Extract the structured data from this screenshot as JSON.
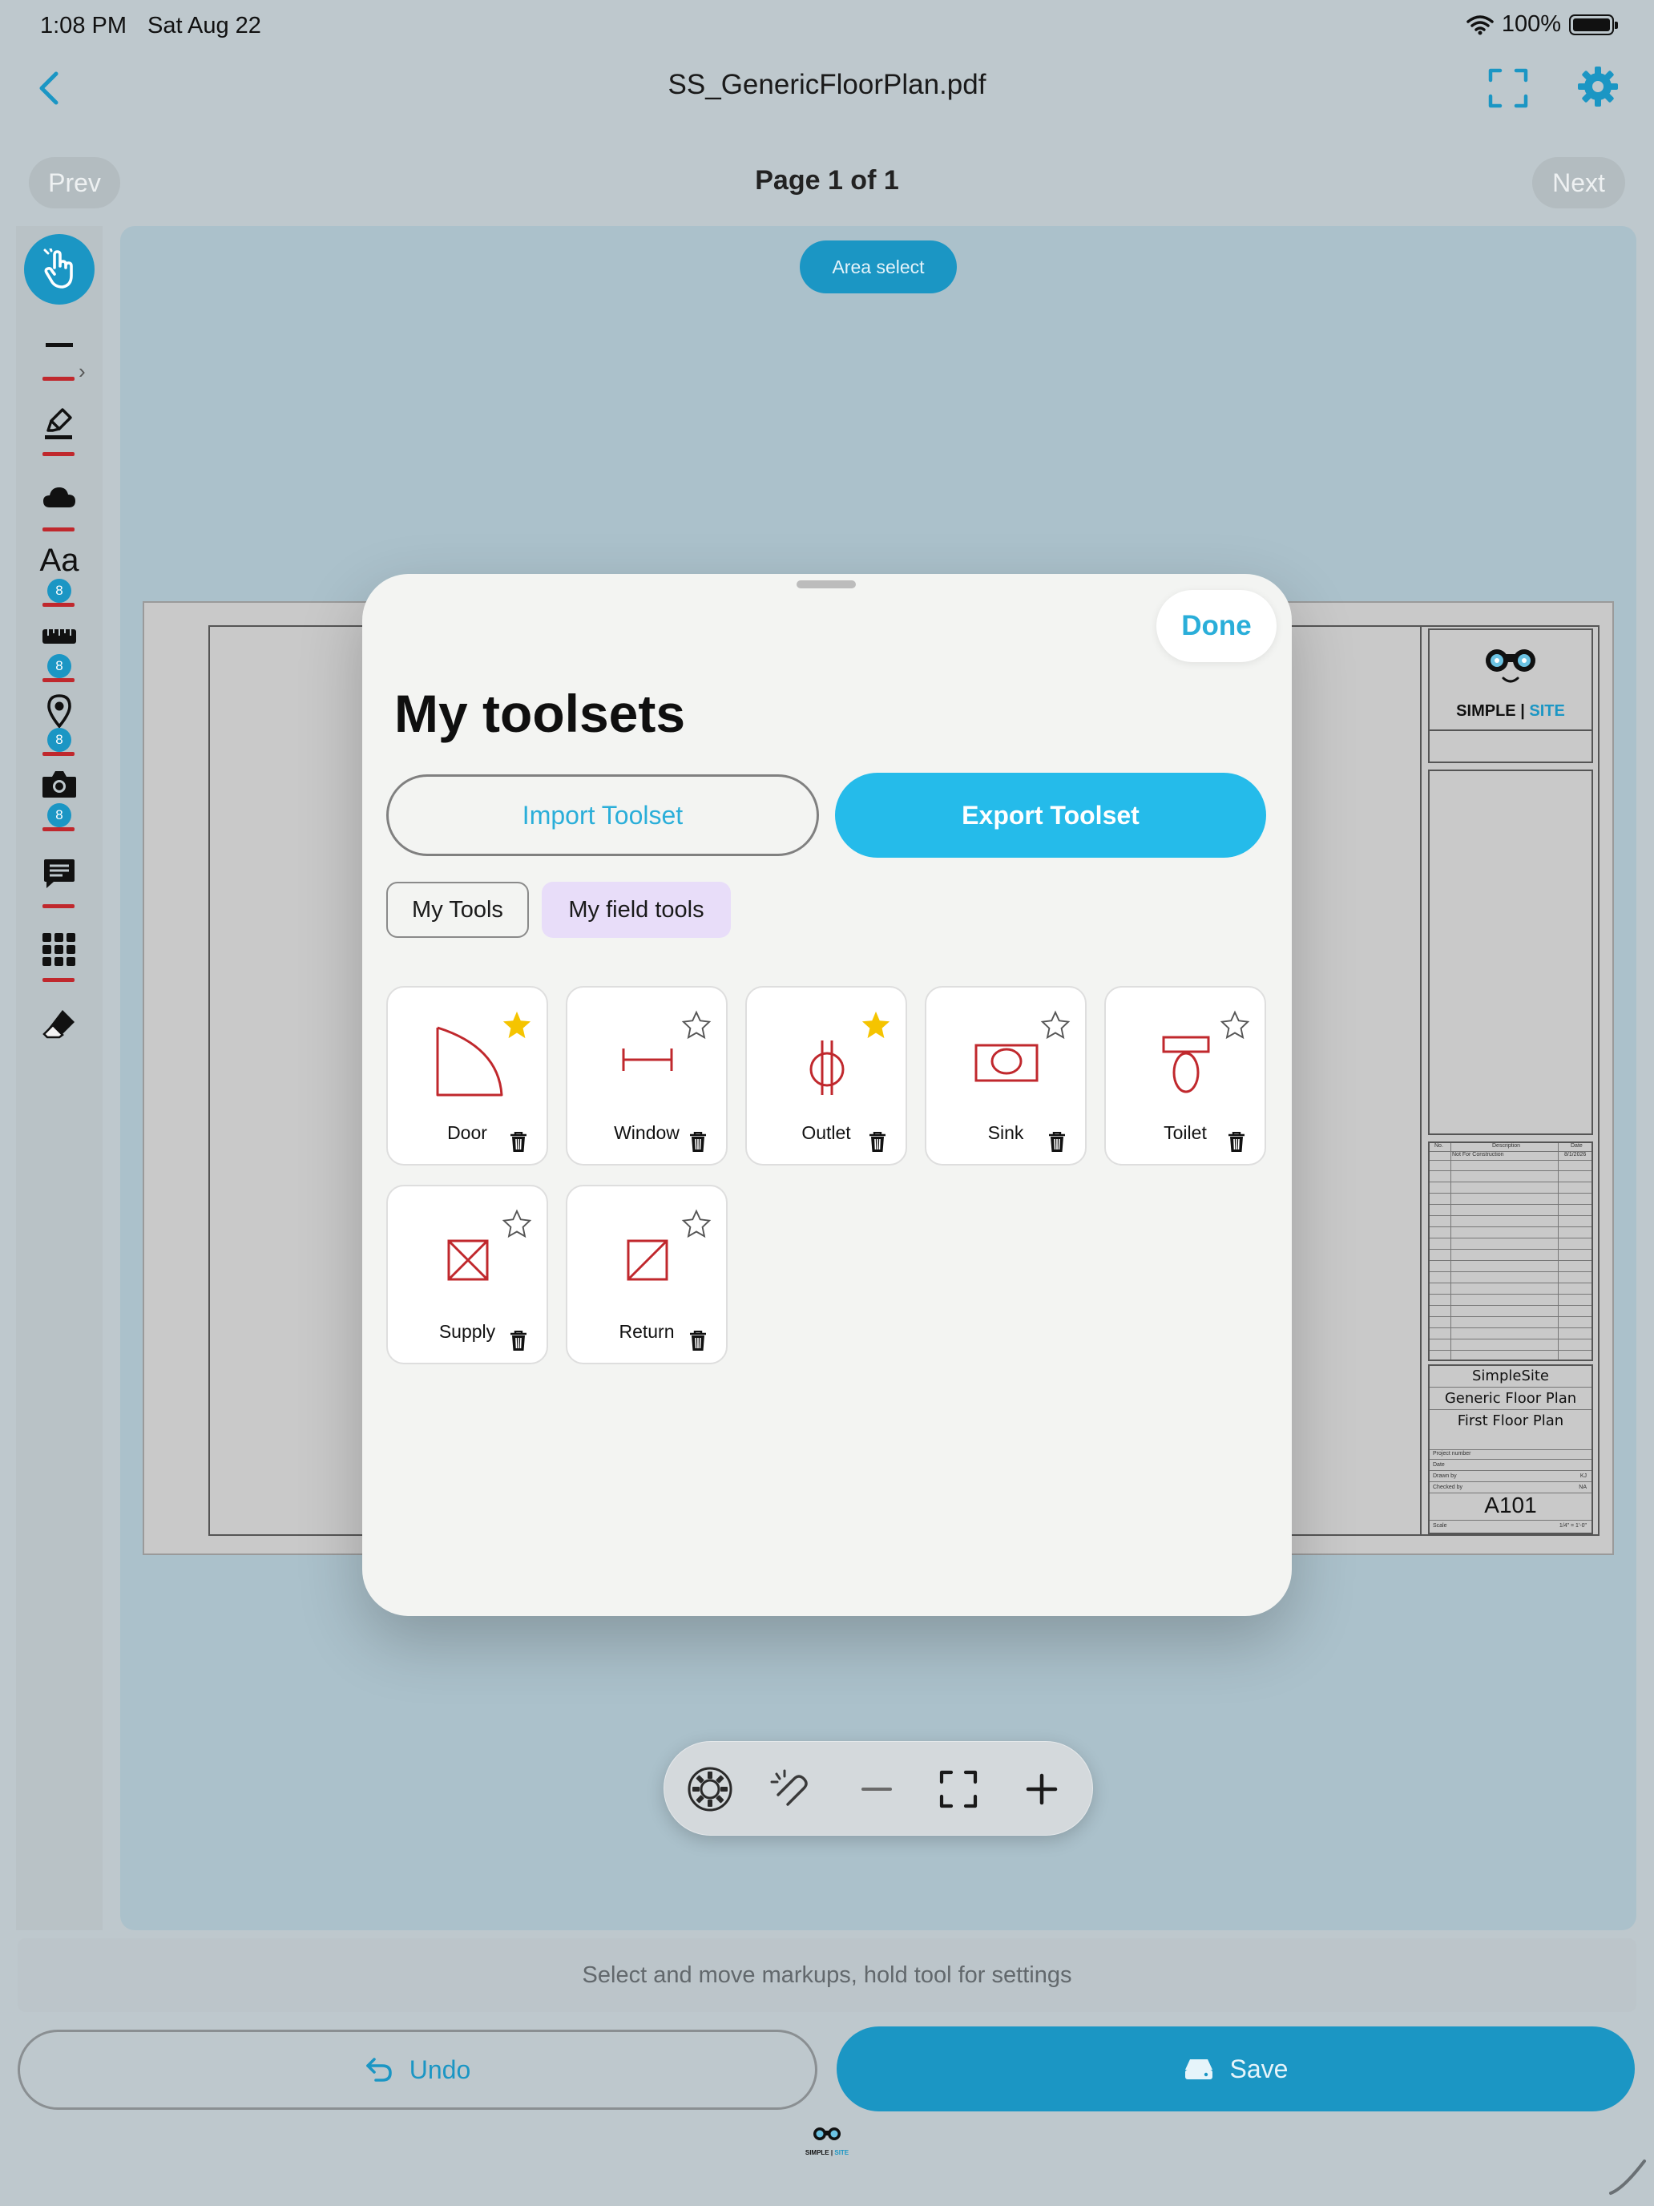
{
  "status_bar": {
    "time": "1:08 PM",
    "date": "Sat Aug 22",
    "battery": "100%"
  },
  "nav": {
    "title": "SS_GenericFloorPlan.pdf"
  },
  "pager": {
    "prev_label": "Prev",
    "next_label": "Next",
    "page_indicator": "Page 1 of 1"
  },
  "sidebar": {
    "badge_count": "8"
  },
  "canvas": {
    "area_select_label": "Area select"
  },
  "pdf": {
    "logo_simple": "SIMPLE",
    "logo_sep": "|",
    "logo_site": "SITE",
    "project_name": "SimpleSite",
    "drawing_title": "Generic Floor Plan",
    "sheet_title": "First Floor Plan",
    "sheet_number": "A101",
    "revision_headers": [
      "No.",
      "Description",
      "Date"
    ],
    "revision_row": [
      "",
      "Not For Construction",
      "8/1/2026"
    ],
    "field_labels": [
      "Project number",
      "Date",
      "Drawn by",
      "Checked by"
    ],
    "drawn_by": "KJ",
    "checked_by": "NA",
    "scale_label": "Scale",
    "scale_value": "1/4\" = 1'-0\""
  },
  "modal": {
    "done_label": "Done",
    "title": "My toolsets",
    "import_label": "Import Toolset",
    "export_label": "Export Toolset",
    "tabs": [
      {
        "label": "My Tools",
        "selected": false
      },
      {
        "label": "My field tools",
        "selected": true
      }
    ],
    "tools": [
      {
        "name": "Door",
        "favorite": true,
        "icon": "door-icon"
      },
      {
        "name": "Window",
        "favorite": false,
        "icon": "window-icon"
      },
      {
        "name": "Outlet",
        "favorite": true,
        "icon": "outlet-icon"
      },
      {
        "name": "Sink",
        "favorite": false,
        "icon": "sink-icon"
      },
      {
        "name": "Toilet",
        "favorite": false,
        "icon": "toilet-icon"
      },
      {
        "name": "Supply",
        "favorite": false,
        "icon": "supply-icon"
      },
      {
        "name": "Return",
        "favorite": false,
        "icon": "return-icon"
      }
    ]
  },
  "hint": "Select and move markups, hold tool for settings",
  "actions": {
    "undo_label": "Undo",
    "save_label": "Save"
  },
  "footer": {
    "logo_simple": "SIMPLE",
    "logo_sep": "|",
    "logo_site": "SITE"
  },
  "colors": {
    "accent": "#1b96c4",
    "export_button": "#25bbea",
    "symbol_red": "#c0282d",
    "favorite_star": "#f5c400",
    "selected_tab": "#e8ddf9"
  }
}
